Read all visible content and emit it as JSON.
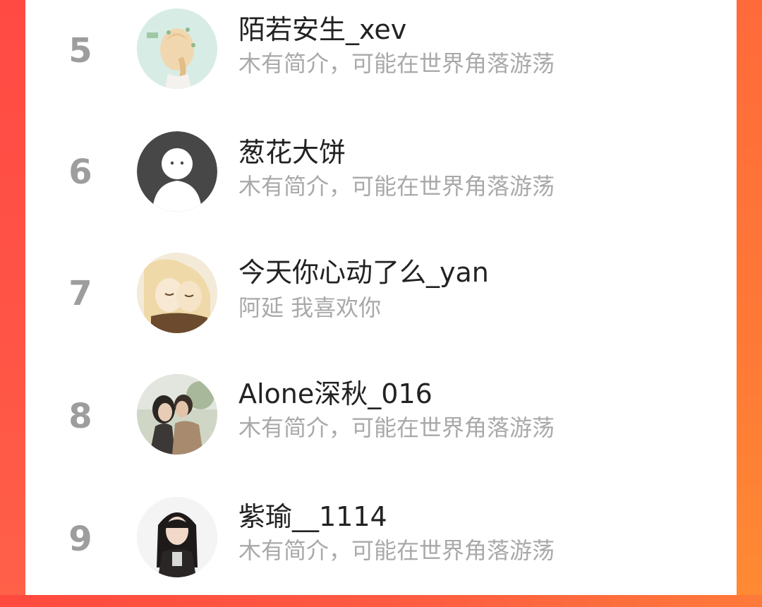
{
  "theme": {
    "accent_left": "#ff4a44",
    "accent_right": "#ff7a36",
    "rank_color": "#9d9d9d",
    "name_color": "#222222",
    "bio_color": "#a9a9a9"
  },
  "ranking": {
    "entries": [
      {
        "rank": "5",
        "name": "陌若安生_xev",
        "bio": "木有简介，可能在世界角落游荡",
        "avatar_icon": "illustrated-girl-avatar"
      },
      {
        "rank": "6",
        "name": "葱花大饼",
        "bio": "木有简介，可能在世界角落游荡",
        "avatar_icon": "default-user-avatar"
      },
      {
        "rank": "7",
        "name": "今天你心动了么_yan",
        "bio": "阿延 我喜欢你",
        "avatar_icon": "anime-couple-avatar"
      },
      {
        "rank": "8",
        "name": "Alone深秋_016",
        "bio": "木有简介，可能在世界角落游荡",
        "avatar_icon": "couple-photo-avatar"
      },
      {
        "rank": "9",
        "name": "紫瑜__1114",
        "bio": "木有简介，可能在世界角落游荡",
        "avatar_icon": "girl-photo-avatar"
      }
    ]
  }
}
